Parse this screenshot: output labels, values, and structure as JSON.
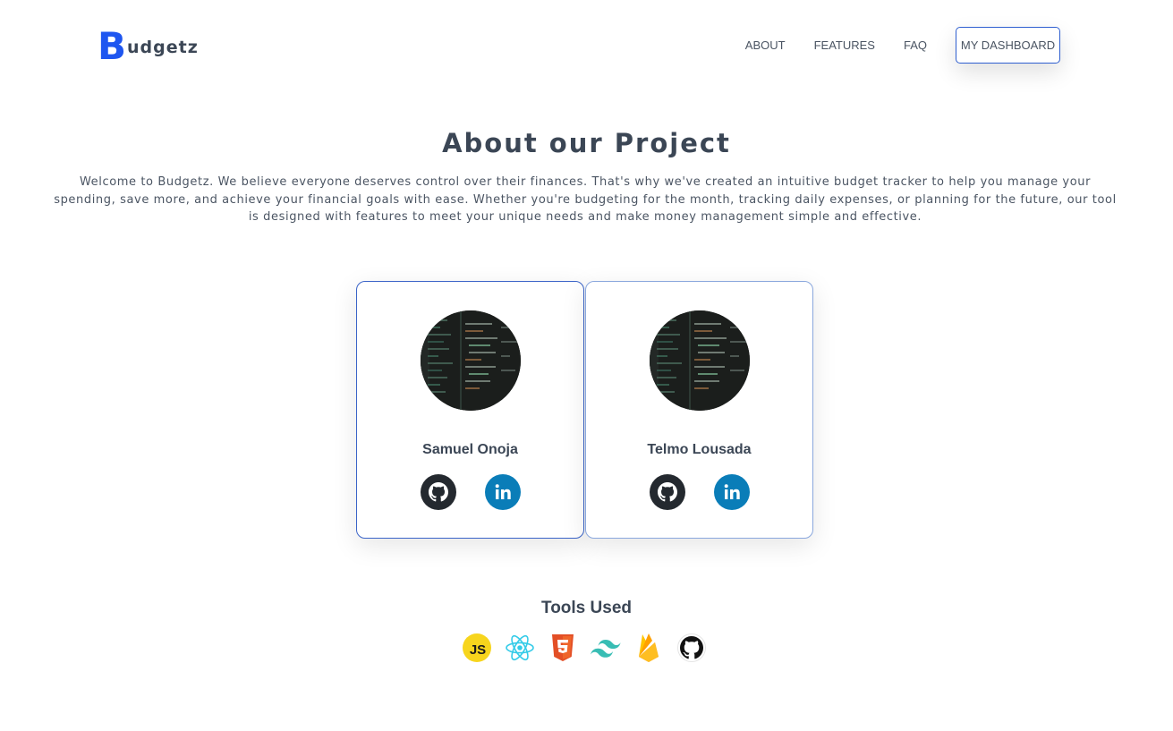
{
  "header": {
    "logo_mark": "B",
    "logo_text": "udgetz",
    "nav": [
      "ABOUT",
      "FEATURES",
      "FAQ"
    ],
    "dashboard_button": "MY DASHBOARD",
    "accent_color": "#1e56f0"
  },
  "about": {
    "title": "About our Project",
    "text": "Welcome to Budgetz. We believe everyone deserves control over their finances. That's why we've created an intuitive budget tracker to help you manage your spending, save more, and achieve your financial goals with ease. Whether you're budgeting for the month, tracking daily expenses, or planning for the future, our tool is designed with features to meet your unique needs and make money management simple and effective."
  },
  "team": [
    {
      "name": "Samuel Onoja",
      "icons": [
        "github-icon",
        "linkedin-icon"
      ]
    },
    {
      "name": "Telmo Lousada",
      "icons": [
        "github-icon",
        "linkedin-icon"
      ]
    }
  ],
  "tools": {
    "title": "Tools Used",
    "icons": [
      "javascript-icon",
      "react-icon",
      "html5-icon",
      "tailwind-icon",
      "firebase-icon",
      "github-icon"
    ],
    "js_label": "JS"
  },
  "colors": {
    "github": "#24292f",
    "linkedin": "#0a7db8"
  }
}
